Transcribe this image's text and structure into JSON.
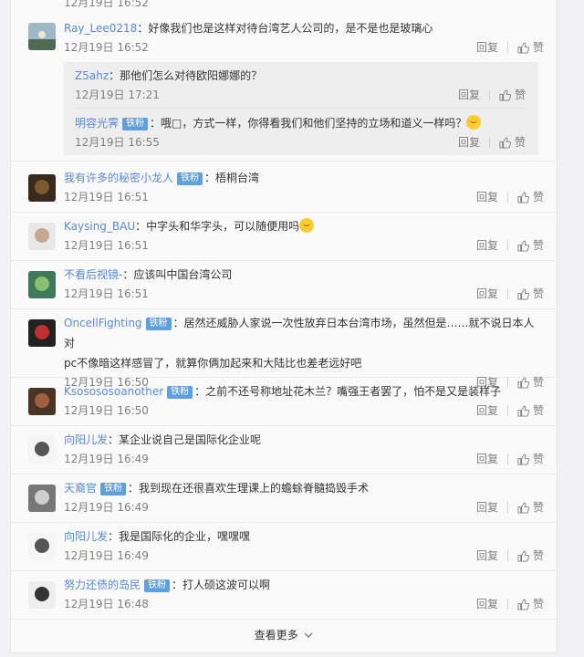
{
  "top_clipped": {
    "time": "12月19日 16:52",
    "reply": "回复",
    "like": "赞"
  },
  "comments": [
    {
      "user": "Ray_Lee0218",
      "badge": "",
      "text": "：好像我们也是这样对待台湾艺人公司的，是不是也是玻璃心",
      "time": "12月19日 16:52",
      "reply": "回复",
      "like": "赞"
    },
    {
      "user": "我有许多的秘密小龙人",
      "badge": "铁粉",
      "text": "：梧桐台湾",
      "time": "12月19日 16:51",
      "reply": "回复",
      "like": "赞"
    },
    {
      "user": "Kaysing_BAU",
      "badge": "",
      "text": "：中字头和华字头，可以随便用吗",
      "time": "12月19日 16:51",
      "reply": "回复",
      "like": "赞"
    },
    {
      "user": "不看后视镜-",
      "badge": "",
      "text": "：应该叫中国台湾公司",
      "time": "12月19日 16:51",
      "reply": "回复",
      "like": "赞"
    },
    {
      "user": "OncellFighting",
      "badge": "铁粉",
      "text": "：居然还威胁人家说一次性放弃日本台湾市场，虽然但是……就不说日本人对",
      "text2": "pc不像暗这样感冒了，就算你俩加起来和大陆比也差老远好吧",
      "time": "12月19日 16:50",
      "reply": "回复",
      "like": "赞"
    },
    {
      "user": "Ksosososoanother",
      "badge": "铁粉",
      "text": "：之前不还号称地址花木兰？嘴强王者罢了，怕不是又是装样子",
      "time": "12月19日 16:50",
      "reply": "回复",
      "like": "赞"
    },
    {
      "user": "向阳儿发",
      "badge": "",
      "text": "：某企业说自己是国际化企业呢",
      "time": "12月19日 16:49",
      "reply": "回复",
      "like": "赞"
    },
    {
      "user": "天裔官",
      "badge": "铁粉",
      "text": "：我到现在还很喜欢生理课上的蟾蜍脊髓捣毁手术",
      "time": "12月19日 16:49",
      "reply": "回复",
      "like": "赞"
    },
    {
      "user": "向阳儿发",
      "badge": "",
      "text": "：我是国际化的企业，嘿嘿嘿",
      "time": "12月19日 16:49",
      "reply": "回复",
      "like": "赞"
    },
    {
      "user": "努力还债的岛民",
      "badge": "铁粉",
      "text": "：打人硕这波可以啊",
      "time": "12月19日 16:48",
      "reply": "回复",
      "like": "赞"
    }
  ],
  "replies": [
    {
      "user": "Z5ahz",
      "badge": "",
      "text": "：那他们怎么对待欧阳娜娜的？",
      "time": "12月19日 17:21",
      "reply": "回复",
      "like": "赞"
    },
    {
      "user": "明容光霁",
      "badge": "铁粉",
      "text": "：哦□，方式一样，你得看我们和他们坚持的立场和道义一样吗？",
      "time": "12月19日 16:55",
      "reply": "回复",
      "like": "赞"
    }
  ],
  "load_more": "查看更多"
}
